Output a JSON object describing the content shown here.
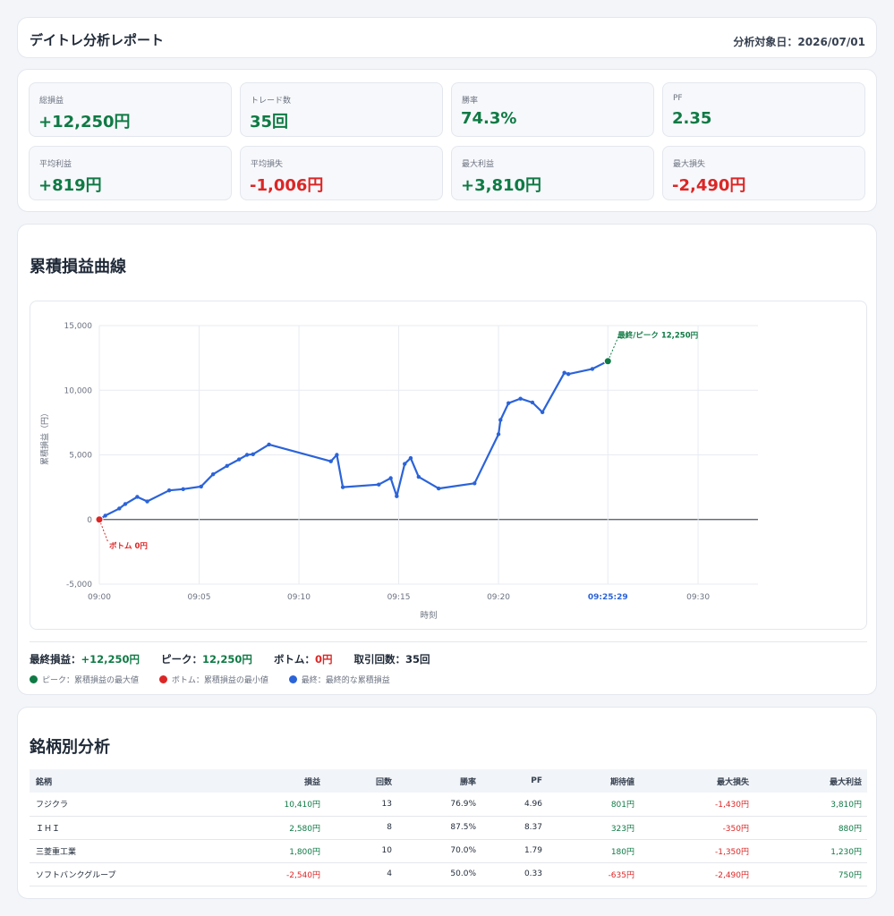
{
  "header": {
    "title": "デイトレ分析レポート",
    "date_label": "分析対象日：2026/07/01"
  },
  "stats": [
    {
      "label": "総損益",
      "value": "+12,250円",
      "tone": "pos"
    },
    {
      "label": "トレード数",
      "value": "35回",
      "tone": "pos"
    },
    {
      "label": "勝率",
      "value": "74.3%",
      "tone": "pos"
    },
    {
      "label": "PF",
      "value": "2.35",
      "tone": "pos"
    },
    {
      "label": "平均利益",
      "value": "+819円",
      "tone": "pos"
    },
    {
      "label": "平均損失",
      "value": "-1,006円",
      "tone": "neg"
    },
    {
      "label": "最大利益",
      "value": "+3,810円",
      "tone": "pos"
    },
    {
      "label": "最大損失",
      "value": "-2,490円",
      "tone": "neg"
    }
  ],
  "chart_section": {
    "title": "累積損益曲線"
  },
  "chart_data": {
    "type": "line",
    "title": "",
    "xlabel": "時刻",
    "ylabel": "累積損益（円）",
    "ylim": [
      -5000,
      15000
    ],
    "xlim_minutes": [
      0,
      33
    ],
    "yticks": [
      -5000,
      0,
      5000,
      10000,
      15000
    ],
    "ytick_labels": [
      "-5,000",
      "0",
      "5,000",
      "10,000",
      "15,000"
    ],
    "xticks_minutes": [
      0,
      5,
      10,
      15,
      20,
      25.48,
      30
    ],
    "xtick_labels": [
      "09:00",
      "09:05",
      "09:10",
      "09:15",
      "09:20",
      "09:25:29",
      "09:30"
    ],
    "highlight_xtick": "09:25:29",
    "grid": true,
    "series": [
      {
        "color": "#2b63d9",
        "x_minutes": [
          0,
          0.3,
          1.0,
          1.3,
          1.9,
          2.4,
          3.5,
          4.2,
          5.1,
          5.7,
          6.4,
          7.0,
          7.4,
          7.7,
          8.5,
          11.6,
          11.9,
          12.2,
          14.0,
          14.6,
          14.9,
          15.3,
          15.6,
          16.0,
          17.0,
          18.8,
          20.0,
          20.1,
          20.5,
          21.1,
          21.7,
          22.2,
          23.3,
          23.5,
          24.7,
          25.48
        ],
        "y": [
          0,
          300,
          850,
          1200,
          1750,
          1400,
          2250,
          2350,
          2550,
          3500,
          4150,
          4650,
          5000,
          5050,
          5800,
          4500,
          5000,
          2500,
          2700,
          3200,
          1800,
          4300,
          4750,
          3300,
          2400,
          2800,
          6600,
          7700,
          9000,
          9350,
          9050,
          8300,
          11350,
          11250,
          11650,
          12250
        ]
      }
    ],
    "annotations": [
      {
        "label": "最終/ピーク 12,250円",
        "x_minutes": 25.48,
        "y": 12250,
        "color": "#0f7a45"
      },
      {
        "label": "ボトム 0円",
        "x_minutes": 0,
        "y": 0,
        "color": "#dc2626"
      }
    ]
  },
  "summary": {
    "final_label": "最終損益：",
    "final_value": "+12,250円",
    "peak_label": "ピーク：",
    "peak_value": "12,250円",
    "bottom_label": "ボトム：",
    "bottom_value": "0円",
    "count_label": "取引回数：35回"
  },
  "legend": [
    {
      "label": "ピーク：累積損益の最大値",
      "color": "#0f7a45"
    },
    {
      "label": "ボトム：累積損益の最小値",
      "color": "#dc2626"
    },
    {
      "label": "最終：最終的な累積損益",
      "color": "#2b63d9"
    }
  ],
  "table_section": {
    "title": "銘柄別分析",
    "columns": [
      "銘柄",
      "損益",
      "回数",
      "勝率",
      "PF",
      "期待値",
      "最大損失",
      "最大利益"
    ],
    "rows": [
      [
        "フジクラ",
        "10,410円",
        "13",
        "76.9%",
        "4.96",
        "801円",
        "-1,430円",
        "3,810円"
      ],
      [
        "ＩＨＩ",
        "2,580円",
        "8",
        "87.5%",
        "8.37",
        "323円",
        "-350円",
        "880円"
      ],
      [
        "三菱重工業",
        "1,800円",
        "10",
        "70.0%",
        "1.79",
        "180円",
        "-1,350円",
        "1,230円"
      ],
      [
        "ソフトバンクグループ",
        "-2,540円",
        "4",
        "50.0%",
        "0.33",
        "-635円",
        "-2,490円",
        "750円"
      ]
    ]
  },
  "colors": {
    "positive": "#0f7a45",
    "negative": "#dc2626",
    "line": "#2b63d9",
    "highlight_tick": "#2b63d9"
  }
}
